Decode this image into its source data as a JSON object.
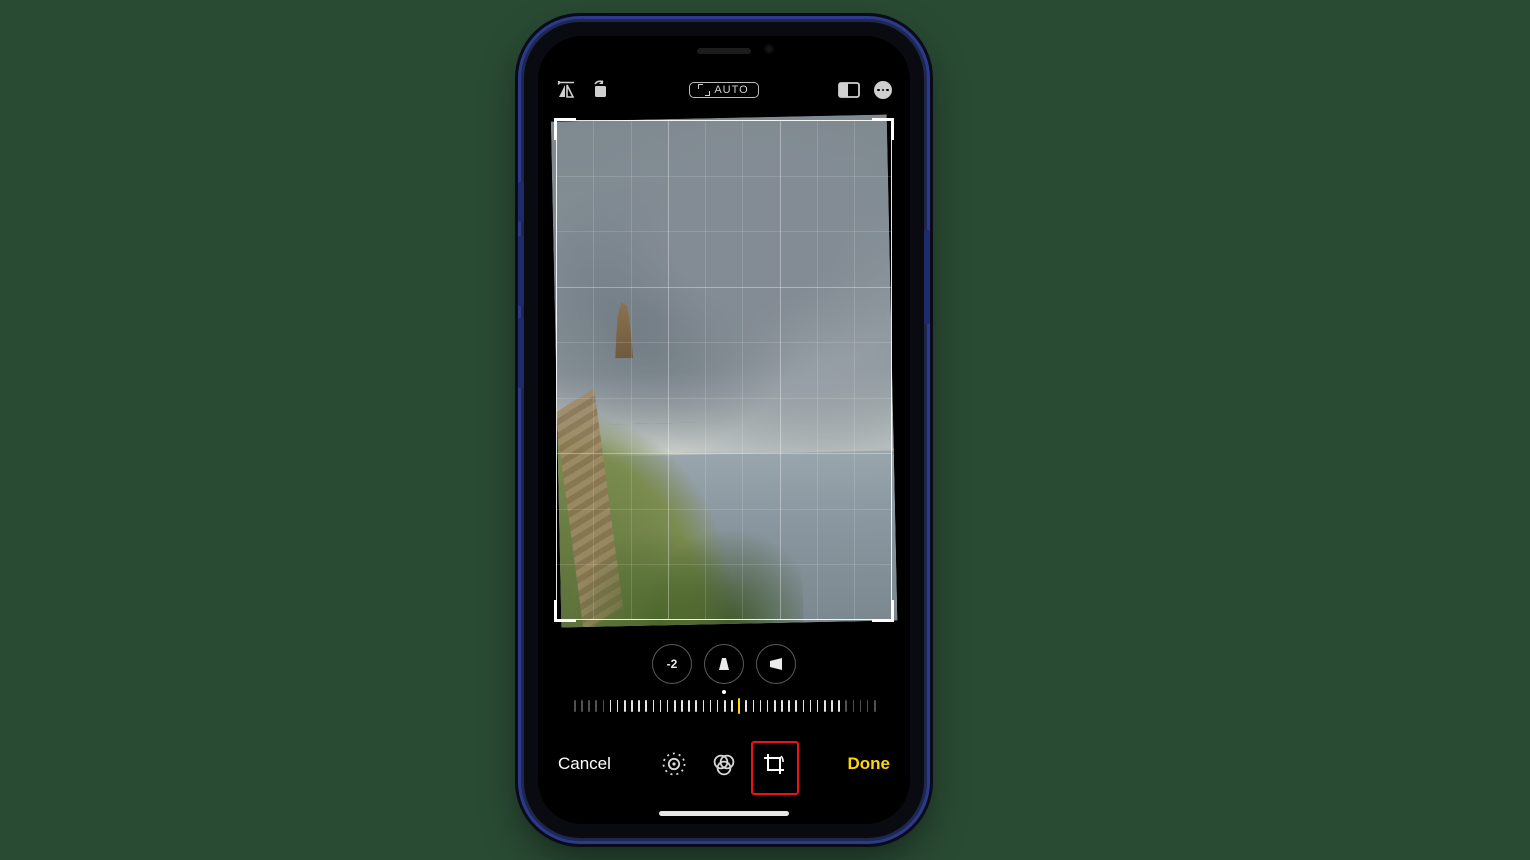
{
  "page": {
    "background": "#294a33"
  },
  "topbar": {
    "flip_icon": "flip-horizontal-icon",
    "rotate_icon": "rotate-icon",
    "auto_label": "AUTO",
    "aspect_icon": "aspect-ratio-icon",
    "more_icon": "more-icon"
  },
  "controls": {
    "straighten_value": "-2",
    "horizontal_icon": "perspective-horizontal-icon",
    "vertical_icon": "perspective-vertical-icon"
  },
  "dial": {
    "tick_count": 43,
    "center_index": 23,
    "indicator_color": "#ffd60a",
    "value": -2
  },
  "tools": {
    "adjust_icon": "adjust-icon",
    "filters_icon": "filters-icon",
    "crop_icon": "crop-rotate-icon",
    "active": "crop",
    "active_indicator_color": "#ffd60a"
  },
  "bottom": {
    "cancel_label": "Cancel",
    "done_label": "Done",
    "done_color": "#ffd60a"
  },
  "highlight": {
    "target": "crop-tool-button",
    "color": "#e11"
  },
  "crop": {
    "rows": 3,
    "cols": 3,
    "fine_rows": 9,
    "fine_cols": 9,
    "rotation_deg": -1.2
  }
}
